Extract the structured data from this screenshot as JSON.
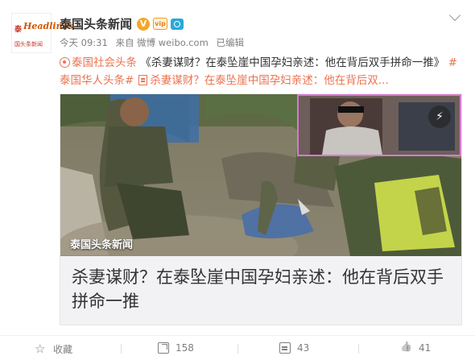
{
  "header": {
    "avatar_logo_top": "泰",
    "avatar_logo_script": "Headlines",
    "avatar_logo_sub": "国头条新闻",
    "author": "泰国头条新闻",
    "verified_icon": "V",
    "vip_badge": "vip",
    "meta_time": "今天 09:31",
    "meta_source": "来自 微博 weibo.com",
    "meta_edited": "已编辑"
  },
  "post": {
    "topic1": "泰国社会头条",
    "quote": "《杀妻谋财？在泰坠崖中国孕妇亲述：他在背后双手拼命一推》",
    "topic2": "#泰国华人头条#",
    "article_link": "杀妻谋财？在泰坠崖中国孕妇亲述：他在背后双..."
  },
  "card": {
    "photo_caption": "泰国头条新闻",
    "title": "杀妻谋财？在泰坠崖中国孕妇亲述：他在背后双手拼命一推"
  },
  "actions": {
    "favorite_label": "收藏",
    "share_count": "158",
    "comment_count": "43",
    "like_count": "41"
  },
  "colors": {
    "link": "#eb7350",
    "meta_text": "#808080",
    "card_bg": "#f2f2f5"
  },
  "icons": [
    "chevron-down-icon",
    "verified-icon",
    "vip-icon",
    "camera-icon",
    "topic-icon",
    "article-icon",
    "play-icon",
    "star-icon",
    "share-icon",
    "comment-icon",
    "like-icon"
  ]
}
